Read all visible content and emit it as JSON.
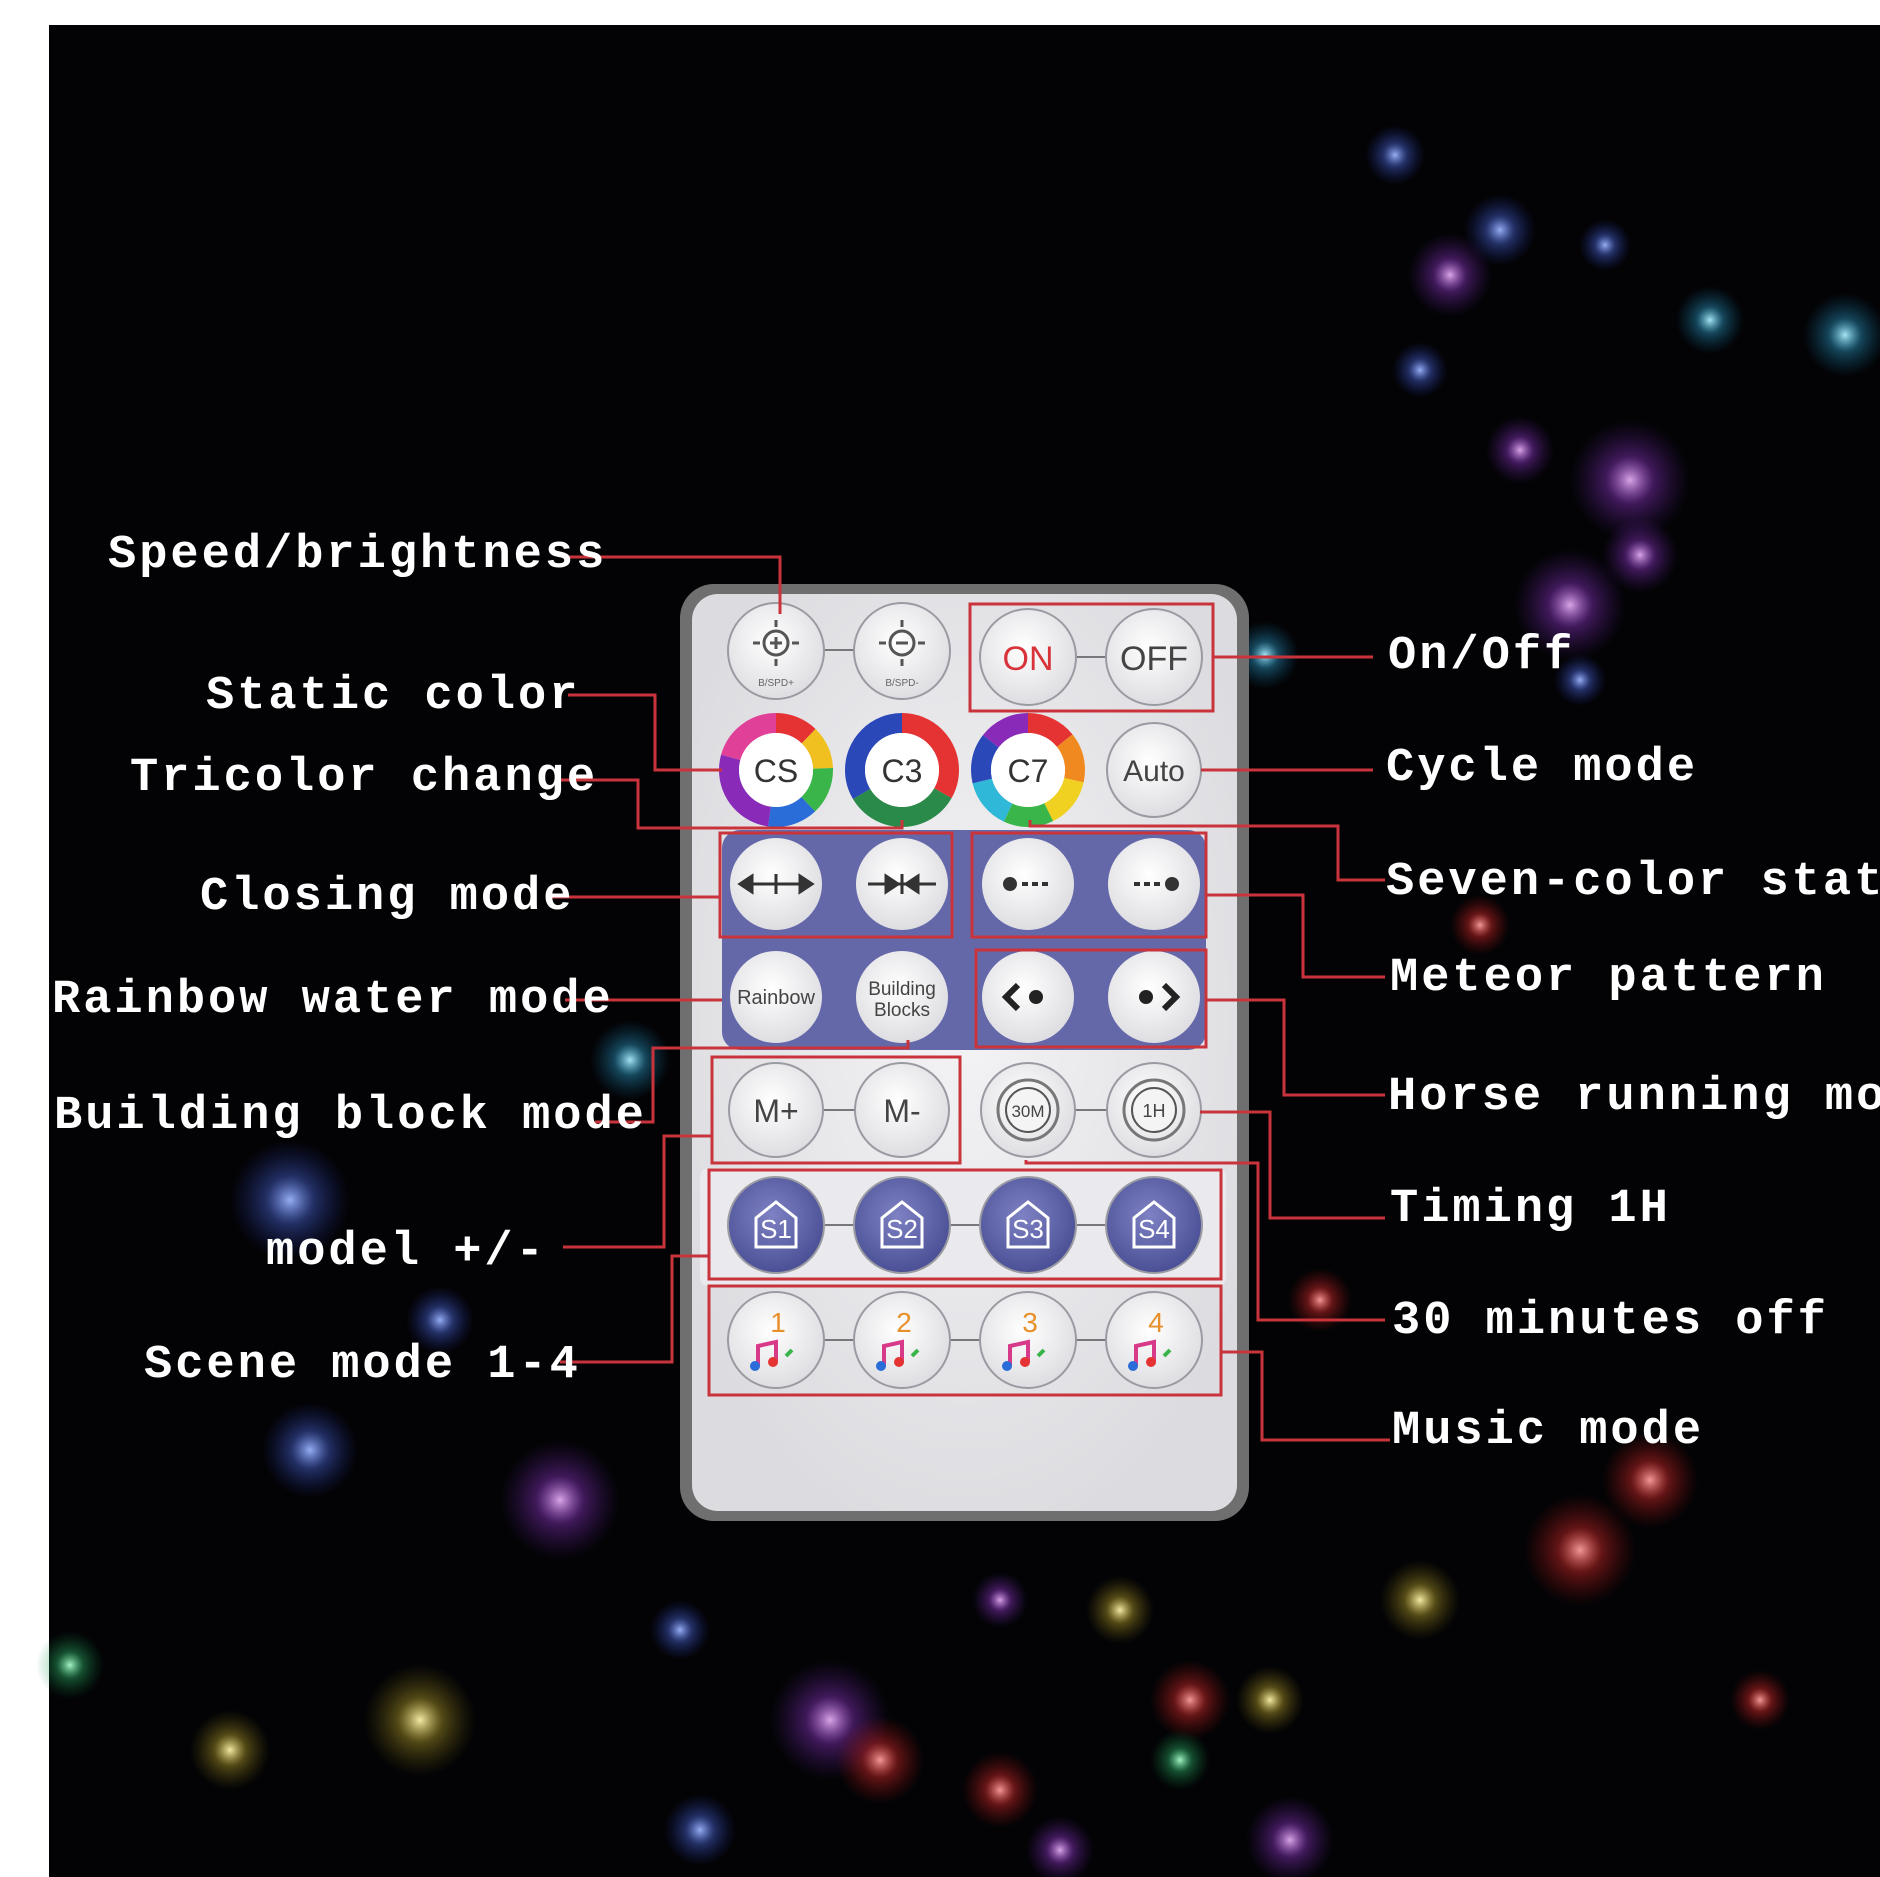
{
  "labels": {
    "speed_brightness": "Speed/brightness",
    "static_color": "Static color",
    "tricolor_change": "Tricolor change",
    "closing_mode": "Closing mode",
    "rainbow_water_mode": "Rainbow water mode",
    "building_block_mode": "Building block mode",
    "model_plus_minus": "model +/-",
    "scene_mode": "Scene mode 1-4",
    "on_off": "On/Off",
    "cycle_mode": "Cycle mode",
    "seven_color_static": "Seven-color static",
    "meteor_pattern": "Meteor pattern",
    "horse_running_mode": "Horse running mode",
    "timing_1h": "Timing 1H",
    "thirty_minutes_off": "30 minutes off",
    "music_mode": "Music mode"
  },
  "buttons": {
    "bright_up_sub": "B/SPD+",
    "bright_down_sub": "B/SPD-",
    "on": "ON",
    "off": "OFF",
    "cs": "CS",
    "c3": "C3",
    "c7": "C7",
    "auto": "Auto",
    "rainbow": "Rainbow",
    "building_1": "Building",
    "building_2": "Blocks",
    "m_plus": "M+",
    "m_minus": "M-",
    "t30": "30M",
    "t1h": "1H",
    "s1": "S1",
    "s2": "S2",
    "s3": "S3",
    "s4": "S4",
    "music_1": "1",
    "music_2": "2",
    "music_3": "3",
    "music_4": "4"
  },
  "colors": {
    "background": "#030305",
    "remote_body": "#eaeaec",
    "remote_frame": "#6f6f6f",
    "panel_blue": "#6467a8",
    "callout_red": "#c9343c",
    "on_text": "#d8333b",
    "music_number": "#e8902a"
  }
}
